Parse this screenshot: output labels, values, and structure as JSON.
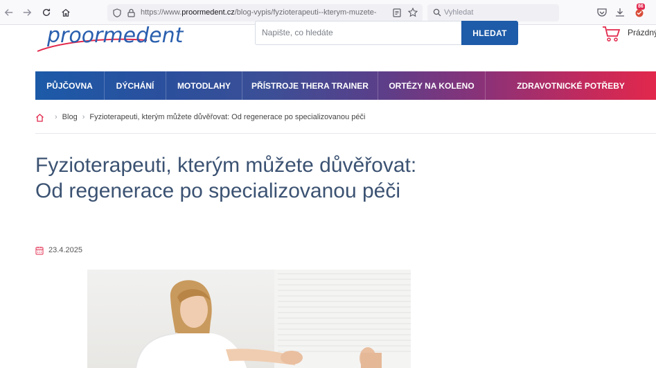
{
  "browser": {
    "url_prefix": "https://www.",
    "url_domain": "proormedent.cz",
    "url_path": "/blog-vypis/fyzioterapeuti--kterym-muzete-du",
    "search_placeholder": "Vyhledat",
    "badge_count": "86"
  },
  "site": {
    "logo_text": "proormedent",
    "search_placeholder": "Napište, co hledáte",
    "search_button": "HLEDAT",
    "cart_label": "Prázdný"
  },
  "menu": [
    {
      "label": "PŮJČOVNA"
    },
    {
      "label": "DÝCHÁNÍ"
    },
    {
      "label": "MOTODLAHY"
    },
    {
      "label": "PŘÍSTROJE THERA TRAINER"
    },
    {
      "label": "ORTÉZY NA KOLENO"
    },
    {
      "label": "ZDRAVOTNICKÉ POTŘEBY"
    }
  ],
  "breadcrumb": {
    "blog": "Blog",
    "current": "Fyzioterapeuti, kterým můžete důvěřovat: Od regenerace po specializovanou péči"
  },
  "article": {
    "title": "Fyzioterapeuti, kterým můžete důvěřovat: Od regenerace po specializovanou péči",
    "date": "23.4.2025"
  },
  "colors": {
    "brand_blue": "#1e5ba8",
    "brand_red": "#e2284c",
    "title": "#3b5272"
  }
}
